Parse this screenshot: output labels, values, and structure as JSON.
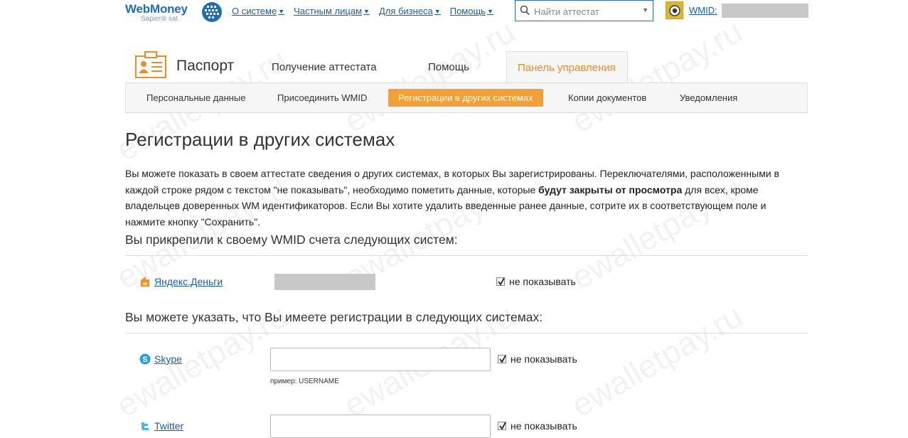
{
  "header": {
    "logo_text": "WebMoney",
    "logo_sub": "Sapienti sat",
    "nav": [
      {
        "label": "О системе"
      },
      {
        "label": "Частным лицам"
      },
      {
        "label": "Для бизнеса"
      },
      {
        "label": "Помощь"
      }
    ],
    "search_placeholder": "Найти аттестат",
    "wmid_label": "WMID:"
  },
  "passport": {
    "title": "Паспорт",
    "tabs": [
      {
        "label": "Получение аттестата"
      },
      {
        "label": "Помощь"
      },
      {
        "label": "Панель управления",
        "active": true
      }
    ],
    "subtabs": [
      {
        "label": "Персональные данные"
      },
      {
        "label": "Присоединить WMID"
      },
      {
        "label": "Регистрации в других системах",
        "active": true
      },
      {
        "label": "Копии документов"
      },
      {
        "label": "Уведомления"
      }
    ]
  },
  "content": {
    "title": "Регистрации в других системах",
    "desc_part1": "Вы можете показать в своем аттестате сведения о других системах, в которых Вы зарегистрированы. Переключателями, расположенными в каждой строке рядом с текстом \"не показывать\", необходимо пометить данные, которые ",
    "desc_bold": "будут закрыты от просмотра",
    "desc_part2": " для всех, кроме владельцев доверенных WM идентификаторов. Если Вы хотите удалить введенные ранее данные, сотрите их в соответствующем поле и нажмите кнопку \"Сохранить\".",
    "attached_heading": "Вы прикрепили к своему WMID счета следующих систем:",
    "attached": [
      {
        "name": "Яндекс.Деньги",
        "hide_label": "не показывать",
        "hidden": true
      }
    ],
    "registrations_heading": "Вы можете указать, что Вы имеете регистрации в следующих системах:",
    "registrations": [
      {
        "name": "Skype",
        "value": "",
        "example": "пример: USERNAME",
        "hide_label": "не показывать",
        "hidden": true
      },
      {
        "name": "Twitter",
        "value": "",
        "hide_label": "не показывать",
        "hidden": true
      }
    ]
  },
  "watermark": "ewalletpay.ru",
  "colors": {
    "accent": "#f2a03a",
    "link": "#1b5ea8",
    "brand": "#1f6db5"
  }
}
